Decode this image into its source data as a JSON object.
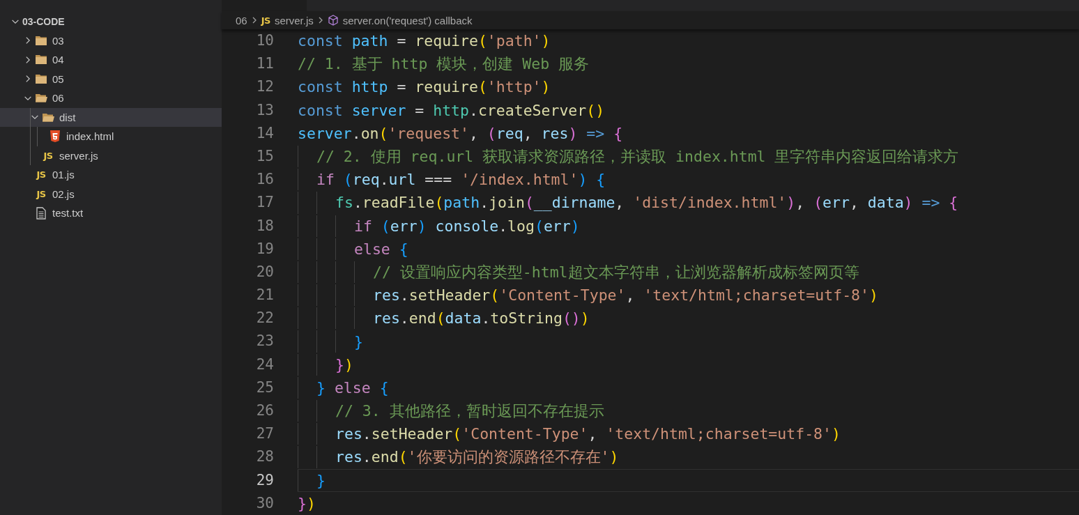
{
  "explorer": {
    "tree": [
      {
        "name": "03-CODE",
        "kind": "root",
        "expanded": true,
        "selected": false,
        "children": [
          {
            "name": "03",
            "kind": "folder",
            "expanded": false,
            "selected": false
          },
          {
            "name": "04",
            "kind": "folder",
            "expanded": false,
            "selected": false
          },
          {
            "name": "05",
            "kind": "folder",
            "expanded": false,
            "selected": false
          },
          {
            "name": "06",
            "kind": "folder",
            "expanded": true,
            "selected": false,
            "children": [
              {
                "name": "dist",
                "kind": "folder",
                "expanded": true,
                "selected": true,
                "children": [
                  {
                    "name": "index.html",
                    "kind": "html",
                    "selected": false
                  }
                ]
              },
              {
                "name": "server.js",
                "kind": "js",
                "badge": "JS",
                "selected": false
              }
            ]
          },
          {
            "name": "01.js",
            "kind": "js",
            "badge": "JS",
            "selected": false
          },
          {
            "name": "02.js",
            "kind": "js",
            "badge": "JS",
            "selected": false
          },
          {
            "name": "test.txt",
            "kind": "txt",
            "selected": false
          }
        ]
      }
    ]
  },
  "breadcrumb": [
    {
      "text": "06",
      "kind": "folder"
    },
    {
      "text": "server.js",
      "kind": "js",
      "badge": "JS"
    },
    {
      "text": "server.on('request') callback",
      "kind": "symbol"
    }
  ],
  "editor": {
    "lines": [
      {
        "number": "10",
        "current": false,
        "tokens": [
          {
            "kind": "kw",
            "text": "const "
          },
          {
            "kind": "const",
            "text": "path"
          },
          {
            "kind": "op",
            "text": " = "
          },
          {
            "kind": "fn",
            "text": "require"
          },
          {
            "kind": "b1",
            "text": "("
          },
          {
            "kind": "str",
            "text": "'path'"
          },
          {
            "kind": "b1",
            "text": ")"
          }
        ]
      },
      {
        "number": "11",
        "current": false,
        "tokens": [
          {
            "kind": "com",
            "text": "// 1. 基于 http 模块，创建 Web 服务"
          }
        ]
      },
      {
        "number": "12",
        "current": false,
        "tokens": [
          {
            "kind": "kw",
            "text": "const "
          },
          {
            "kind": "const",
            "text": "http"
          },
          {
            "kind": "op",
            "text": " = "
          },
          {
            "kind": "fn",
            "text": "require"
          },
          {
            "kind": "b1",
            "text": "("
          },
          {
            "kind": "str",
            "text": "'http'"
          },
          {
            "kind": "b1",
            "text": ")"
          }
        ]
      },
      {
        "number": "13",
        "current": false,
        "tokens": [
          {
            "kind": "kw",
            "text": "const "
          },
          {
            "kind": "const",
            "text": "server"
          },
          {
            "kind": "op",
            "text": " = "
          },
          {
            "kind": "type",
            "text": "http"
          },
          {
            "kind": "op",
            "text": "."
          },
          {
            "kind": "fn",
            "text": "createServer"
          },
          {
            "kind": "b1",
            "text": "()"
          }
        ]
      },
      {
        "number": "14",
        "current": false,
        "tokens": [
          {
            "kind": "const",
            "text": "server"
          },
          {
            "kind": "op",
            "text": "."
          },
          {
            "kind": "fn",
            "text": "on"
          },
          {
            "kind": "b1",
            "text": "("
          },
          {
            "kind": "str",
            "text": "'request'"
          },
          {
            "kind": "op",
            "text": ", "
          },
          {
            "kind": "b2",
            "text": "("
          },
          {
            "kind": "var",
            "text": "req"
          },
          {
            "kind": "op",
            "text": ", "
          },
          {
            "kind": "var",
            "text": "res"
          },
          {
            "kind": "b2",
            "text": ")"
          },
          {
            "kind": "kw",
            "text": " =>"
          },
          {
            "kind": "b2",
            "text": " {"
          }
        ]
      },
      {
        "number": "15",
        "current": false,
        "tokens": [
          {
            "kind": "com",
            "text": "  // 2. 使用 req.url 获取请求资源路径，并读取 index.html 里字符串内容返回给请求方"
          }
        ]
      },
      {
        "number": "16",
        "current": false,
        "tokens": [
          {
            "kind": "ctl",
            "text": "  if"
          },
          {
            "kind": "b3",
            "text": " ("
          },
          {
            "kind": "var",
            "text": "req"
          },
          {
            "kind": "op",
            "text": "."
          },
          {
            "kind": "var",
            "text": "url"
          },
          {
            "kind": "op",
            "text": " === "
          },
          {
            "kind": "str",
            "text": "'/index.html'"
          },
          {
            "kind": "b3",
            "text": ")"
          },
          {
            "kind": "b3",
            "text": " {"
          }
        ]
      },
      {
        "number": "17",
        "current": false,
        "tokens": [
          {
            "kind": "type",
            "text": "    fs"
          },
          {
            "kind": "op",
            "text": "."
          },
          {
            "kind": "fn",
            "text": "readFile"
          },
          {
            "kind": "b1",
            "text": "("
          },
          {
            "kind": "const",
            "text": "path"
          },
          {
            "kind": "op",
            "text": "."
          },
          {
            "kind": "fn",
            "text": "join"
          },
          {
            "kind": "b2",
            "text": "("
          },
          {
            "kind": "var",
            "text": "__dirname"
          },
          {
            "kind": "op",
            "text": ", "
          },
          {
            "kind": "str",
            "text": "'dist/index.html'"
          },
          {
            "kind": "b2",
            "text": ")"
          },
          {
            "kind": "op",
            "text": ", "
          },
          {
            "kind": "b2",
            "text": "("
          },
          {
            "kind": "var",
            "text": "err"
          },
          {
            "kind": "op",
            "text": ", "
          },
          {
            "kind": "var",
            "text": "data"
          },
          {
            "kind": "b2",
            "text": ")"
          },
          {
            "kind": "kw",
            "text": " =>"
          },
          {
            "kind": "b2",
            "text": " {"
          }
        ]
      },
      {
        "number": "18",
        "current": false,
        "tokens": [
          {
            "kind": "ctl",
            "text": "      if"
          },
          {
            "kind": "b3",
            "text": " ("
          },
          {
            "kind": "var",
            "text": "err"
          },
          {
            "kind": "b3",
            "text": ")"
          },
          {
            "kind": "var",
            "text": " console"
          },
          {
            "kind": "op",
            "text": "."
          },
          {
            "kind": "fn",
            "text": "log"
          },
          {
            "kind": "b3",
            "text": "("
          },
          {
            "kind": "var",
            "text": "err"
          },
          {
            "kind": "b3",
            "text": ")"
          }
        ]
      },
      {
        "number": "19",
        "current": false,
        "tokens": [
          {
            "kind": "ctl",
            "text": "      else"
          },
          {
            "kind": "b3",
            "text": " {"
          }
        ]
      },
      {
        "number": "20",
        "current": false,
        "tokens": [
          {
            "kind": "com",
            "text": "        // 设置响应内容类型-html超文本字符串，让浏览器解析成标签网页等"
          }
        ]
      },
      {
        "number": "21",
        "current": false,
        "tokens": [
          {
            "kind": "var",
            "text": "        res"
          },
          {
            "kind": "op",
            "text": "."
          },
          {
            "kind": "fn",
            "text": "setHeader"
          },
          {
            "kind": "b1",
            "text": "("
          },
          {
            "kind": "str",
            "text": "'Content-Type'"
          },
          {
            "kind": "op",
            "text": ", "
          },
          {
            "kind": "str",
            "text": "'text/html;charset=utf-8'"
          },
          {
            "kind": "b1",
            "text": ")"
          }
        ]
      },
      {
        "number": "22",
        "current": false,
        "tokens": [
          {
            "kind": "var",
            "text": "        res"
          },
          {
            "kind": "op",
            "text": "."
          },
          {
            "kind": "fn",
            "text": "end"
          },
          {
            "kind": "b1",
            "text": "("
          },
          {
            "kind": "var",
            "text": "data"
          },
          {
            "kind": "op",
            "text": "."
          },
          {
            "kind": "fn",
            "text": "toString"
          },
          {
            "kind": "b2",
            "text": "()"
          },
          {
            "kind": "b1",
            "text": ")"
          }
        ]
      },
      {
        "number": "23",
        "current": false,
        "tokens": [
          {
            "kind": "b3",
            "text": "      }"
          }
        ]
      },
      {
        "number": "24",
        "current": false,
        "tokens": [
          {
            "kind": "b2",
            "text": "    }"
          },
          {
            "kind": "b1",
            "text": ")"
          }
        ]
      },
      {
        "number": "25",
        "current": false,
        "tokens": [
          {
            "kind": "b3",
            "text": "  }"
          },
          {
            "kind": "ctl",
            "text": " else"
          },
          {
            "kind": "b3",
            "text": " {"
          }
        ]
      },
      {
        "number": "26",
        "current": false,
        "tokens": [
          {
            "kind": "com",
            "text": "    // 3. 其他路径，暂时返回不存在提示"
          }
        ]
      },
      {
        "number": "27",
        "current": false,
        "tokens": [
          {
            "kind": "var",
            "text": "    res"
          },
          {
            "kind": "op",
            "text": "."
          },
          {
            "kind": "fn",
            "text": "setHeader"
          },
          {
            "kind": "b1",
            "text": "("
          },
          {
            "kind": "str",
            "text": "'Content-Type'"
          },
          {
            "kind": "op",
            "text": ", "
          },
          {
            "kind": "str",
            "text": "'text/html;charset=utf-8'"
          },
          {
            "kind": "b1",
            "text": ")"
          }
        ]
      },
      {
        "number": "28",
        "current": false,
        "tokens": [
          {
            "kind": "var",
            "text": "    res"
          },
          {
            "kind": "op",
            "text": "."
          },
          {
            "kind": "fn",
            "text": "end"
          },
          {
            "kind": "b1",
            "text": "("
          },
          {
            "kind": "str",
            "text": "'你要访问的资源路径不存在'"
          },
          {
            "kind": "b1",
            "text": ")"
          }
        ]
      },
      {
        "number": "29",
        "current": true,
        "tokens": [
          {
            "kind": "b3",
            "text": "  }"
          }
        ]
      },
      {
        "number": "30",
        "current": false,
        "tokens": [
          {
            "kind": "b2",
            "text": "}"
          },
          {
            "kind": "b1",
            "text": ")"
          }
        ]
      }
    ]
  }
}
